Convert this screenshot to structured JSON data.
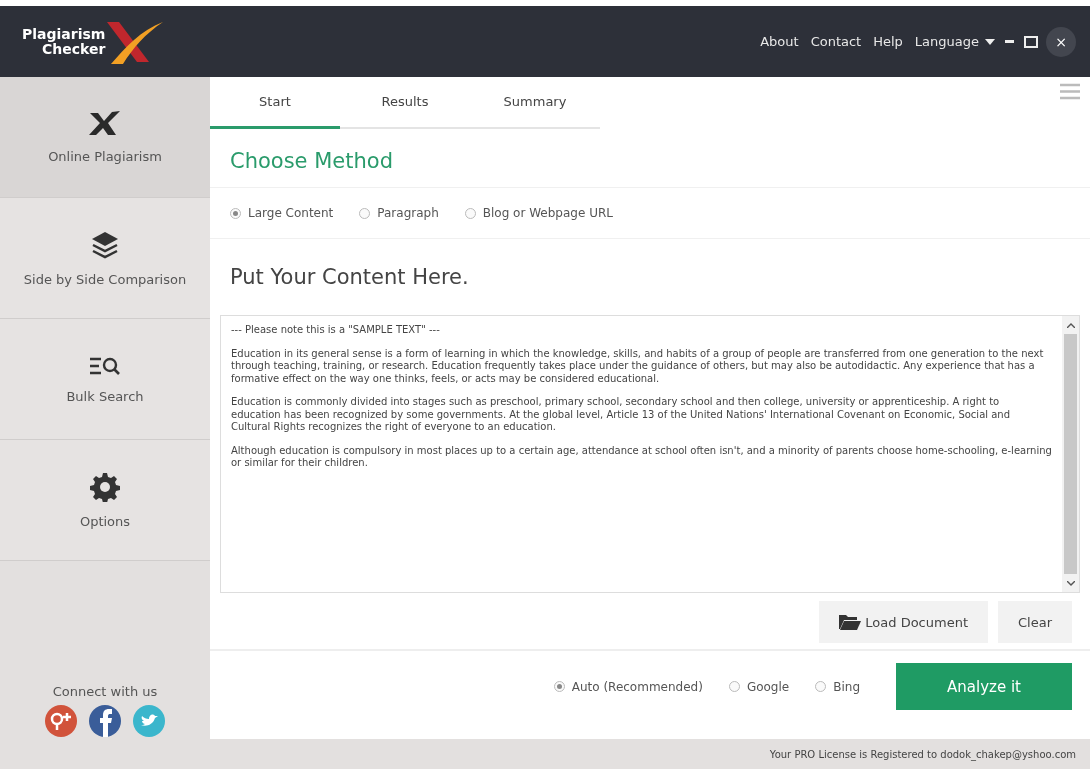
{
  "logo": {
    "line_1": "Plagiarism",
    "line_2": "Checker"
  },
  "header_links": [
    "About",
    "Contact",
    "Help"
  ],
  "language": {
    "label": "Language"
  },
  "window_controls": {
    "close": "×"
  },
  "sidebar": {
    "items": [
      {
        "label": "Online Plagiarism",
        "selected": true
      },
      {
        "label": "Side by Side Comparison",
        "selected": false
      },
      {
        "label": "Bulk Search",
        "selected": false
      },
      {
        "label": "Options",
        "selected": false
      }
    ],
    "connect_label": "Connect with us"
  },
  "tabs": [
    {
      "label": "Start",
      "selected": true
    },
    {
      "label": "Results",
      "selected": false
    },
    {
      "label": "Summary",
      "selected": false
    }
  ],
  "method_title": "Choose Method",
  "methods": [
    {
      "label": "Large Content",
      "selected": true
    },
    {
      "label": "Paragraph",
      "selected": false
    },
    {
      "label": "Blog or Webpage URL",
      "selected": false
    }
  ],
  "content_title": "Put Your Content Here.",
  "content_paragraphs": [
    "--- Please note this is a \"SAMPLE TEXT\" ---",
    "Education in its general sense is a form of learning in which the knowledge, skills, and habits of a group of people are transferred from one generation to the next through teaching, training, or research. Education frequently takes place under the guidance of others, but may also be autodidactic. Any experience that has a formative effect on the way one thinks, feels, or acts may be considered educational.",
    "Education is commonly divided into stages such as preschool, primary school, secondary school and then college, university or apprenticeship. A right to education has been recognized by some governments. At the global level, Article 13 of the United Nations' International Covenant on Economic, Social and Cultural Rights recognizes the right of everyone to an education.",
    "Although education is compulsory in most places up to a certain age, attendance at school often isn't, and a minority of parents choose home-schooling, e-learning or similar for their children."
  ],
  "load_button": "Load Document",
  "clear_button": "Clear",
  "engines": [
    {
      "label": "Auto (Recommended)",
      "selected": true
    },
    {
      "label": "Google",
      "selected": false
    },
    {
      "label": "Bing",
      "selected": false
    }
  ],
  "analyze_button": "Analyze it",
  "status_bar": "Your PRO License is Registered to dodok_chakep@yshoo.com"
}
